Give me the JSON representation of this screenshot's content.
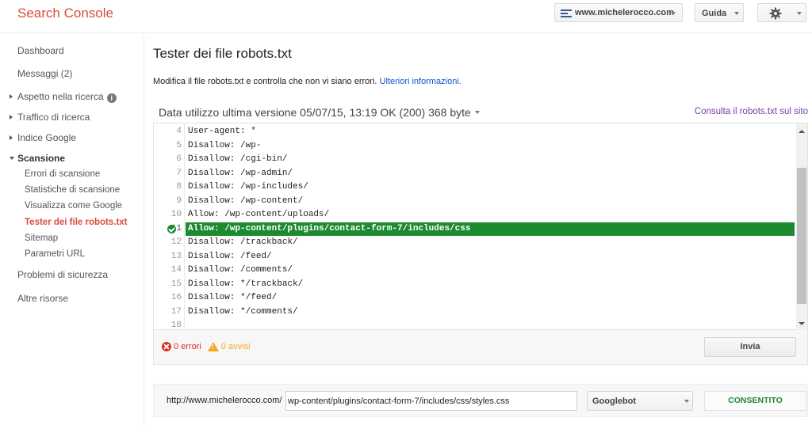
{
  "app": {
    "title": "Search Console"
  },
  "header": {
    "site": "www.michelerocco.com",
    "help_label": "Guida"
  },
  "sidebar": {
    "dashboard": "Dashboard",
    "messages": "Messaggi (2)",
    "search_appearance": "Aspetto nella ricerca",
    "search_traffic": "Traffico di ricerca",
    "google_index": "Indice Google",
    "crawl": "Scansione",
    "crawl_items": [
      "Errori di scansione",
      "Statistiche di scansione",
      "Visualizza come Google",
      "Tester dei file robots.txt",
      "Sitemap",
      "Parametri URL"
    ],
    "security": "Problemi di sicurezza",
    "other": "Altre risorse"
  },
  "main": {
    "title": "Tester dei file robots.txt",
    "description": "Modifica il file robots.txt e controlla che non vi siano errori.",
    "more_info": "Ulteriori informazioni.",
    "version": "Data utilizzo ultima versione 05/07/15, 13:19 OK (200) 368 byte",
    "view_link": "Consulta il robots.txt sul sito"
  },
  "editor": {
    "highlighted_line": 11,
    "lines": [
      {
        "n": "4",
        "text": "User-agent: *"
      },
      {
        "n": "5",
        "text": "Disallow: /wp-"
      },
      {
        "n": "6",
        "text": "Disallow: /cgi-bin/"
      },
      {
        "n": "7",
        "text": "Disallow: /wp-admin/"
      },
      {
        "n": "8",
        "text": "Disallow: /wp-includes/"
      },
      {
        "n": "9",
        "text": "Disallow: /wp-content/"
      },
      {
        "n": "10",
        "text": "Allow: /wp-content/uploads/"
      },
      {
        "n": "11",
        "text": "Allow: /wp-content/plugins/contact-form-7/includes/css"
      },
      {
        "n": "12",
        "text": "Disallow: /trackback/"
      },
      {
        "n": "13",
        "text": "Disallow: /feed/"
      },
      {
        "n": "14",
        "text": "Disallow: /comments/"
      },
      {
        "n": "15",
        "text": "Disallow: */trackback/"
      },
      {
        "n": "16",
        "text": "Disallow: */feed/"
      },
      {
        "n": "17",
        "text": "Disallow: */comments/"
      },
      {
        "n": "18",
        "text": ""
      }
    ]
  },
  "status": {
    "errors": "0 errori",
    "warnings": "0 avvisi",
    "submit_label": "Invia"
  },
  "tester": {
    "base_url": "http://www.michelerocco.com/",
    "path": "wp-content/plugins/contact-form-7/includes/css/styles.css",
    "user_agent": "Googlebot",
    "result": "CONSENTITO"
  },
  "colors": {
    "brand": "#dd4b39",
    "allowed": "#1c8a2e",
    "link": "#1155cc",
    "error": "#d93025",
    "warning": "#f5a623"
  }
}
